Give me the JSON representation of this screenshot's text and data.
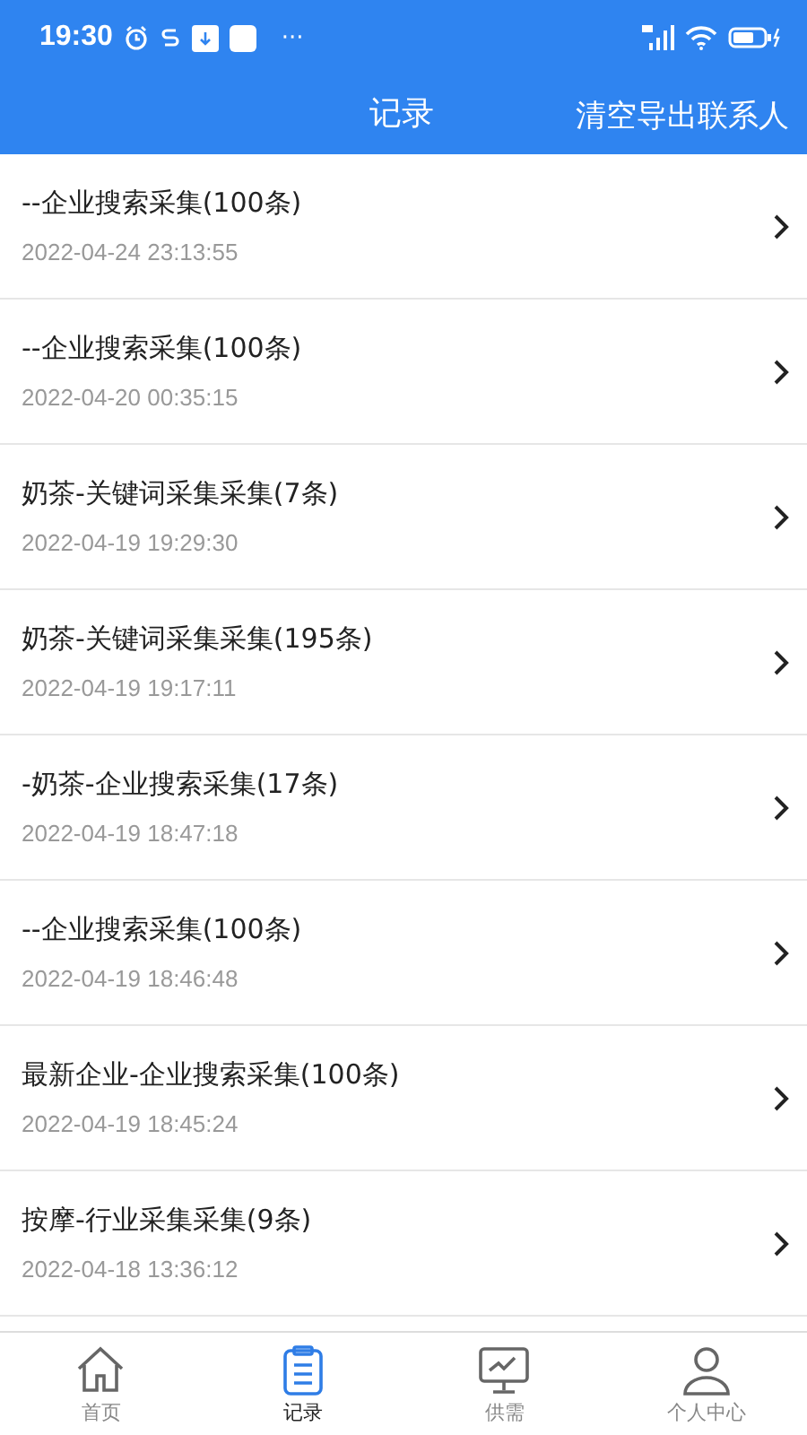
{
  "status_bar": {
    "time": "19:30",
    "more": "···"
  },
  "header": {
    "title": "记录",
    "action": "清空导出联系人"
  },
  "records": [
    {
      "title": "--企业搜索采集(100条)",
      "time": "2022-04-24 23:13:55"
    },
    {
      "title": "--企业搜索采集(100条)",
      "time": "2022-04-20 00:35:15"
    },
    {
      "title": "奶茶-关键词采集采集(7条)",
      "time": "2022-04-19 19:29:30"
    },
    {
      "title": "奶茶-关键词采集采集(195条)",
      "time": "2022-04-19 19:17:11"
    },
    {
      "title": "-奶茶-企业搜索采集(17条)",
      "time": "2022-04-19 18:47:18"
    },
    {
      "title": "--企业搜索采集(100条)",
      "time": "2022-04-19 18:46:48"
    },
    {
      "title": "最新企业-企业搜索采集(100条)",
      "time": "2022-04-19 18:45:24"
    },
    {
      "title": "按摩-行业采集采集(9条)",
      "time": "2022-04-18 13:36:12"
    }
  ],
  "tabs": [
    {
      "label": "首页",
      "kind": "home",
      "selected": false
    },
    {
      "label": "记录",
      "kind": "record",
      "selected": true
    },
    {
      "label": "供需",
      "kind": "supply",
      "selected": false
    },
    {
      "label": "个人中心",
      "kind": "person",
      "selected": false
    }
  ]
}
